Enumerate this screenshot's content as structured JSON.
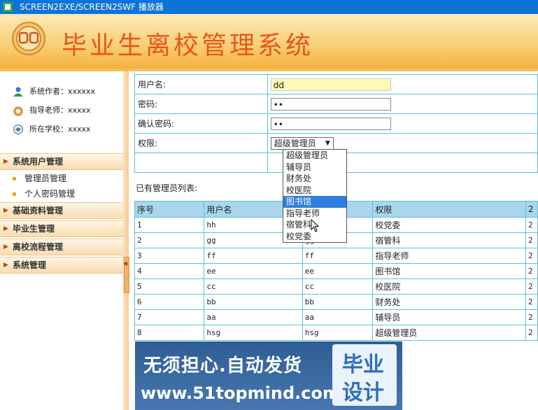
{
  "titlebar": {
    "title": "SCREEN2EXE/SCREEN2SWF 播放器"
  },
  "header": {
    "system_title": "毕业生离校管理系统"
  },
  "sidebar": {
    "info": [
      {
        "icon": "user-icon",
        "text": "系统作者：xxxxxx"
      },
      {
        "icon": "clock-icon",
        "text": "指导老师：xxxxx"
      },
      {
        "icon": "school-icon",
        "text": "所在学校：xxxxx"
      }
    ],
    "sections": [
      {
        "label": "系统用户管理",
        "items": [
          "管理员管理",
          "个人密码管理"
        ]
      },
      {
        "label": "基础资料管理"
      },
      {
        "label": "毕业生管理"
      },
      {
        "label": "离校流程管理"
      },
      {
        "label": "系统管理"
      }
    ]
  },
  "form": {
    "username_label": "用户名:",
    "username_value": "dd",
    "password_label": "密码:",
    "password_value": "••",
    "confirm_label": "确认密码:",
    "confirm_value": "••",
    "role_label": "权限:",
    "role_selected": "超级管理员"
  },
  "dropdown": {
    "options": [
      "超级管理员",
      "辅导员",
      "财务处",
      "校医院",
      "图书馆",
      "指导老师",
      "宿管科",
      "校党委"
    ],
    "highlighted": "图书馆"
  },
  "list": {
    "caption": "已有管理员列表:",
    "headers": [
      "序号",
      "用户名",
      "",
      "权限",
      "2"
    ],
    "rows": [
      [
        "1",
        "hh",
        "",
        "校党委",
        "2"
      ],
      [
        "2",
        "gg",
        "gg",
        "宿管科",
        "2"
      ],
      [
        "3",
        "ff",
        "ff",
        "指导老师",
        "2"
      ],
      [
        "4",
        "ee",
        "ee",
        "图书馆",
        "2"
      ],
      [
        "5",
        "cc",
        "cc",
        "校医院",
        "2"
      ],
      [
        "6",
        "bb",
        "bb",
        "财务处",
        "2"
      ],
      [
        "7",
        "aa",
        "aa",
        "辅导员",
        "2"
      ],
      [
        "8",
        "hsg",
        "hsg",
        "超级管理员",
        "2"
      ]
    ]
  },
  "watermark": {
    "line1": "无须担心.自动发货",
    "line2": "www.51topmind.com",
    "badge1": "毕业",
    "badge2": "设计"
  }
}
